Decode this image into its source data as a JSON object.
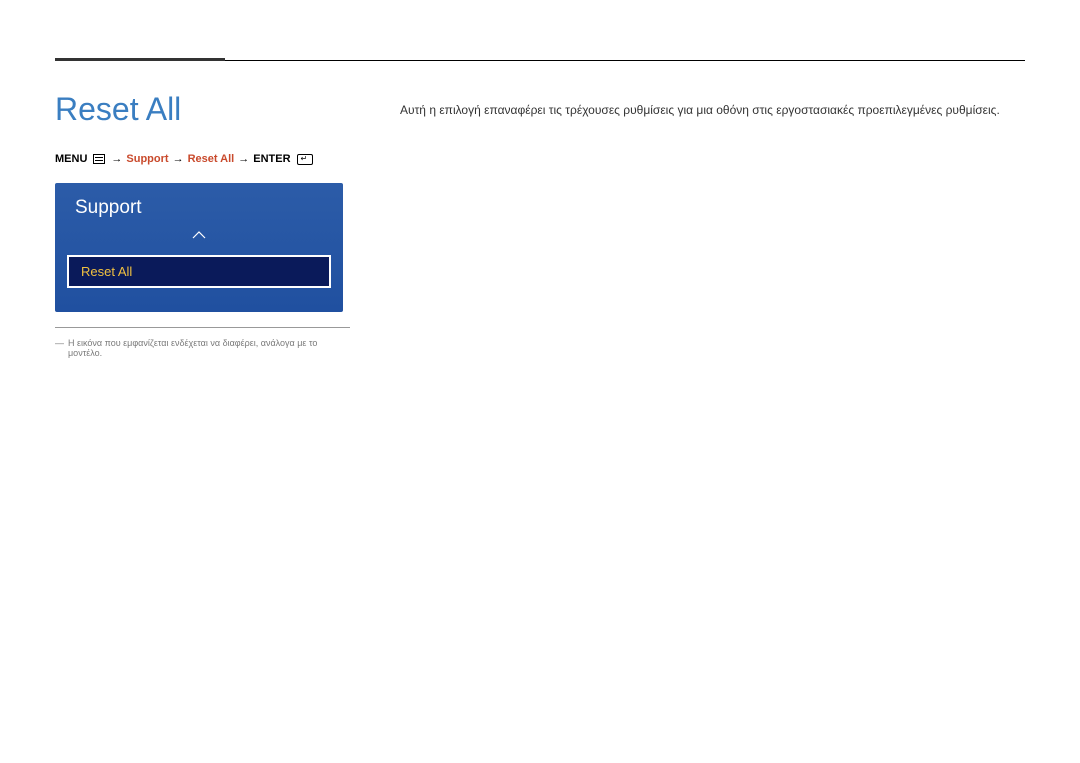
{
  "page": {
    "title": "Reset All"
  },
  "breadcrumb": {
    "menu": "MENU",
    "sep": "→",
    "support": "Support",
    "resetAll": "Reset All",
    "enter": "ENTER"
  },
  "panel": {
    "title": "Support",
    "selectedItem": "Reset All"
  },
  "footnote": {
    "dash": "―",
    "text": "Η εικόνα που εμφανίζεται ενδέχεται να διαφέρει, ανάλογα με το μοντέλο."
  },
  "description": {
    "text": "Αυτή η επιλογή επαναφέρει τις τρέχουσες ρυθμίσεις για μια οθόνη στις εργοστασιακές προεπιλεγμένες ρυθμίσεις."
  }
}
